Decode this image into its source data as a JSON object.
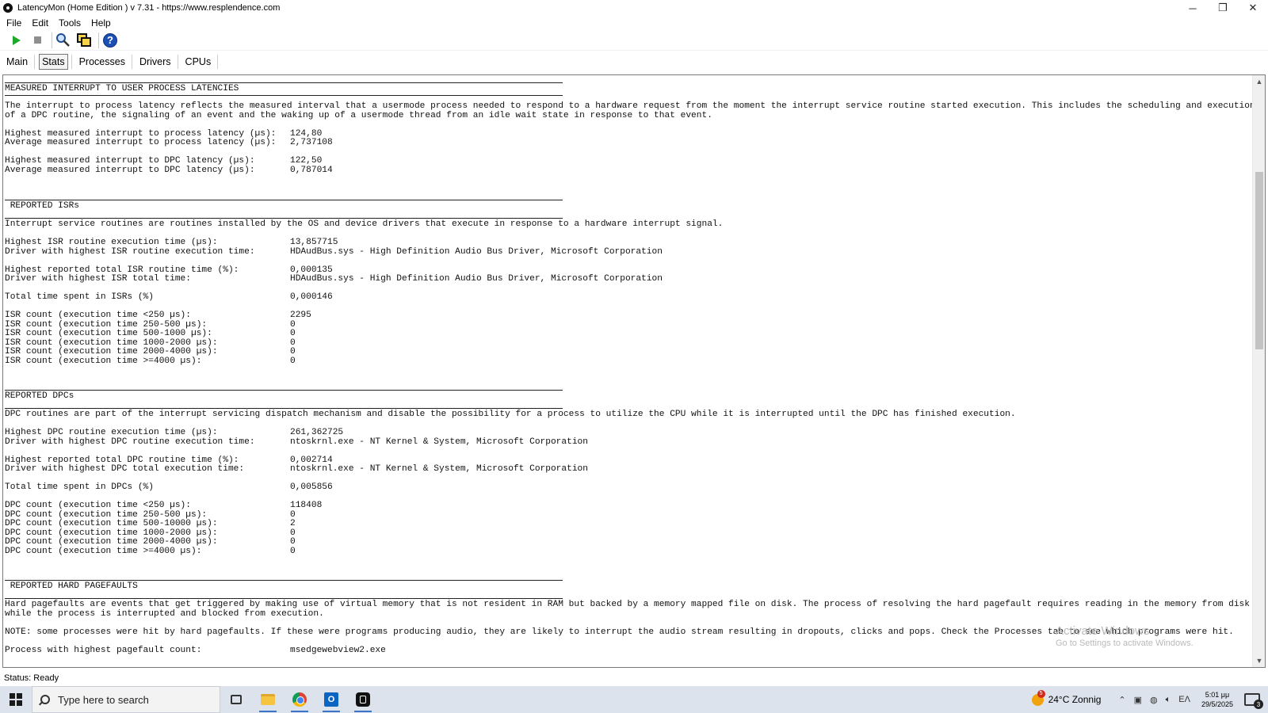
{
  "window": {
    "title": "LatencyMon  (Home Edition )  v 7.31 - https://www.resplendence.com",
    "minimize": "─",
    "restore": "❐",
    "close": "✕"
  },
  "menu": [
    "File",
    "Edit",
    "Tools",
    "Help"
  ],
  "tabs": [
    {
      "label": "Main",
      "active": false
    },
    {
      "label": "Stats",
      "active": true
    },
    {
      "label": "Processes",
      "active": false
    },
    {
      "label": "Drivers",
      "active": false
    },
    {
      "label": "CPUs",
      "active": false
    }
  ],
  "report": {
    "sec1": {
      "heading": "MEASURED INTERRUPT TO USER PROCESS LATENCIES",
      "desc1": "The interrupt to process latency reflects the measured interval that a usermode process needed to respond to a hardware request from the moment the interrupt service routine started execution. This includes the scheduling and execution",
      "desc2": "of a DPC routine, the signaling of an event and the waking up of a usermode thread from an idle wait state in response to that event.",
      "rows": [
        {
          "k": "Highest measured interrupt to process latency (µs):",
          "v": "124,80"
        },
        {
          "k": "Average measured interrupt to process latency (µs):",
          "v": "2,737108"
        },
        {
          "k": "Highest measured interrupt to DPC latency (µs):",
          "v": "122,50"
        },
        {
          "k": "Average measured interrupt to DPC latency (µs):",
          "v": "0,787014"
        }
      ]
    },
    "sec2": {
      "heading": " REPORTED ISRs",
      "desc1": "Interrupt service routines are routines installed by the OS and device drivers that execute in response to a hardware interrupt signal.",
      "rows": [
        {
          "k": "Highest ISR routine execution time (µs):",
          "v": "13,857715"
        },
        {
          "k": "Driver with highest ISR routine execution time:",
          "v": "HDAudBus.sys - High Definition Audio Bus Driver, Microsoft Corporation"
        },
        {
          "k": "Highest reported total ISR routine time (%):",
          "v": "0,000135"
        },
        {
          "k": "Driver with highest ISR total time:",
          "v": "HDAudBus.sys - High Definition Audio Bus Driver, Microsoft Corporation"
        },
        {
          "k": "Total time spent in ISRs (%)",
          "v": "0,000146"
        },
        {
          "k": "ISR count (execution time <250 µs):",
          "v": "2295"
        },
        {
          "k": "ISR count (execution time 250-500 µs):",
          "v": "0"
        },
        {
          "k": "ISR count (execution time 500-1000 µs):",
          "v": "0"
        },
        {
          "k": "ISR count (execution time 1000-2000 µs):",
          "v": "0"
        },
        {
          "k": "ISR count (execution time 2000-4000 µs):",
          "v": "0"
        },
        {
          "k": "ISR count (execution time >=4000 µs):",
          "v": "0"
        }
      ]
    },
    "sec3": {
      "heading": "REPORTED DPCs",
      "desc1": "DPC routines are part of the interrupt servicing dispatch mechanism and disable the possibility for a process to utilize the CPU while it is interrupted until the DPC has finished execution.",
      "rows": [
        {
          "k": "Highest DPC routine execution time (µs):",
          "v": "261,362725"
        },
        {
          "k": "Driver with highest DPC routine execution time:",
          "v": "ntoskrnl.exe - NT Kernel & System, Microsoft Corporation"
        },
        {
          "k": "Highest reported total DPC routine time (%):",
          "v": "0,002714"
        },
        {
          "k": "Driver with highest DPC total execution time:",
          "v": "ntoskrnl.exe - NT Kernel & System, Microsoft Corporation"
        },
        {
          "k": "Total time spent in DPCs (%)",
          "v": "0,005856"
        },
        {
          "k": "DPC count (execution time <250 µs):",
          "v": "118408"
        },
        {
          "k": "DPC count (execution time 250-500 µs):",
          "v": "0"
        },
        {
          "k": "DPC count (execution time 500-10000 µs):",
          "v": "2"
        },
        {
          "k": "DPC count (execution time 1000-2000 µs):",
          "v": "0"
        },
        {
          "k": "DPC count (execution time 2000-4000 µs):",
          "v": "0"
        },
        {
          "k": "DPC count (execution time >=4000 µs):",
          "v": "0"
        }
      ]
    },
    "sec4": {
      "heading": " REPORTED HARD PAGEFAULTS",
      "desc1": "Hard pagefaults are events that get triggered by making use of virtual memory that is not resident in RAM but backed by a memory mapped file on disk. The process of resolving the hard pagefault requires reading in the memory from disk",
      "desc2": "while the process is interrupted and blocked from execution.",
      "note": "NOTE: some processes were hit by hard pagefaults. If these were programs producing audio, they are likely to interrupt the audio stream resulting in dropouts, clicks and pops. Check the Processes tab to see which programs were hit.",
      "rows": [
        {
          "k": "Process with highest pagefault count:",
          "v": "msedgewebview2.exe"
        }
      ]
    }
  },
  "watermark": {
    "line1": "Activate Windows",
    "line2": "Go to Settings to activate Windows."
  },
  "status": "Status: Ready",
  "taskbar": {
    "search_placeholder": "Type here to search",
    "weather": "24°C  Zonnig",
    "weather_badge": "5",
    "lang": "EΛ",
    "time": "5:01 μμ",
    "date": "29/5/2025",
    "notif_count": "3"
  }
}
